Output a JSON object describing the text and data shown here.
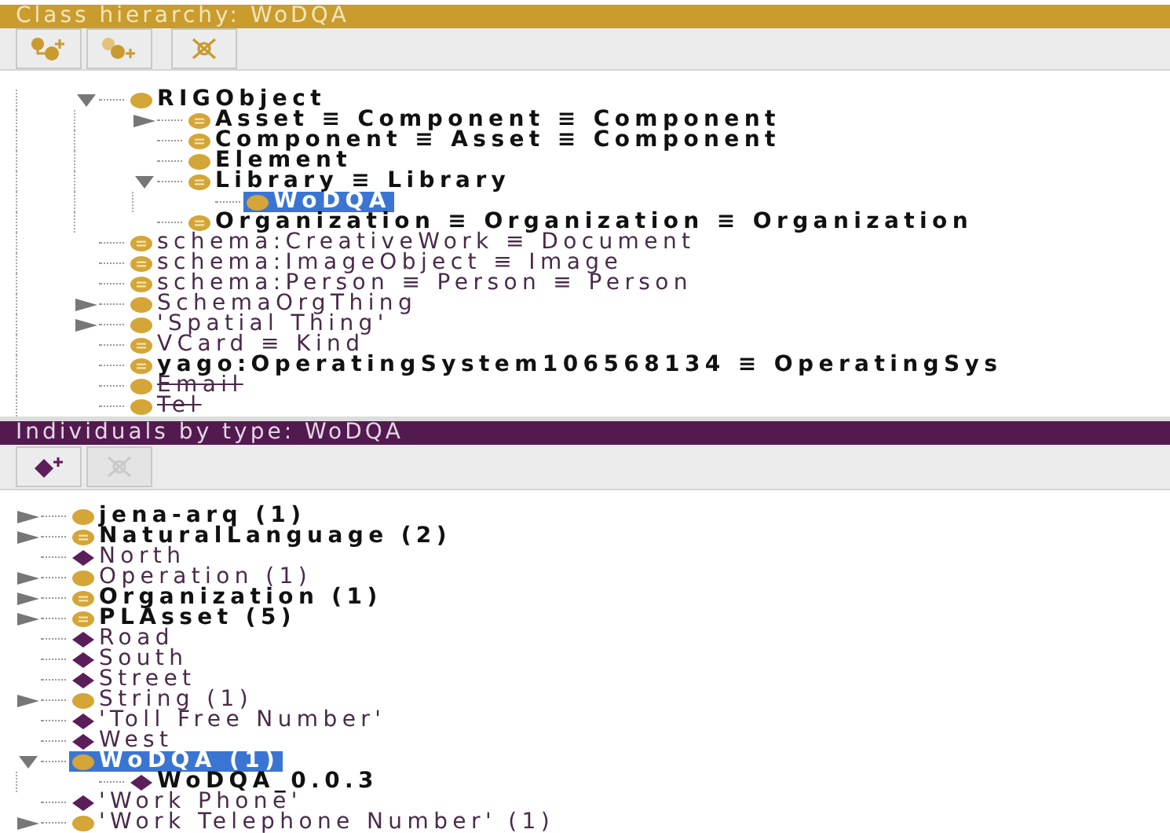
{
  "class_hierarchy": {
    "title": "Class hierarchy: WoDQA",
    "buttons": [
      {
        "kind": "add-subclass",
        "disabled": false
      },
      {
        "kind": "add-sibling",
        "disabled": false
      },
      {
        "kind": "delete",
        "disabled": false
      }
    ],
    "items": [
      {
        "label": "RIGObject",
        "bold": true,
        "equivalent": false,
        "expanded": true,
        "children": [
          {
            "label": "Asset ≡ Component ≡ Component",
            "bold": true,
            "equivalent": true,
            "expanded": false
          },
          {
            "label": "Component ≡ Asset ≡ Component",
            "bold": true,
            "equivalent": true
          },
          {
            "label": "Element",
            "bold": true,
            "equivalent": false
          },
          {
            "label": "Library ≡ Library",
            "bold": true,
            "equivalent": true,
            "expanded": true,
            "children": [
              {
                "label": "WoDQA",
                "bold": true,
                "equivalent": false,
                "selected": true
              }
            ]
          },
          {
            "label": "Organization ≡ Organization ≡ Organization",
            "bold": true,
            "equivalent": true
          }
        ]
      },
      {
        "label": "schema:CreativeWork ≡ Document",
        "bold": false,
        "equivalent": true
      },
      {
        "label": "schema:ImageObject ≡ Image",
        "bold": false,
        "equivalent": true
      },
      {
        "label": "schema:Person ≡ Person ≡ Person",
        "bold": false,
        "equivalent": true
      },
      {
        "label": "SchemaOrgThing",
        "bold": false,
        "equivalent": false,
        "expanded": false
      },
      {
        "label": "'Spatial Thing'",
        "bold": false,
        "equivalent": false,
        "expanded": false
      },
      {
        "label": "VCard ≡ Kind",
        "bold": false,
        "equivalent": true
      },
      {
        "label": "yago:OperatingSystem106568134 ≡ OperatingSys",
        "bold": true,
        "equivalent": true
      },
      {
        "label": "Email",
        "bold": false,
        "equivalent": false,
        "struck": true
      },
      {
        "label": "Tel",
        "bold": false,
        "equivalent": false,
        "struck": true
      }
    ]
  },
  "individuals": {
    "title": "Individuals by type: WoDQA",
    "buttons": [
      {
        "kind": "add-individual",
        "disabled": false
      },
      {
        "kind": "delete",
        "disabled": true
      }
    ],
    "items": [
      {
        "label": "jena-arq (1)",
        "bold": true,
        "kind": "class",
        "expanded": false
      },
      {
        "label": "NaturalLanguage (2)",
        "bold": true,
        "kind": "equivalent",
        "expanded": false
      },
      {
        "label": "North",
        "bold": false,
        "kind": "individual"
      },
      {
        "label": "Operation (1)",
        "bold": false,
        "kind": "class",
        "expanded": false
      },
      {
        "label": "Organization (1)",
        "bold": true,
        "kind": "equivalent",
        "expanded": false
      },
      {
        "label": "PLAsset (5)",
        "bold": true,
        "kind": "equivalent",
        "expanded": false
      },
      {
        "label": "Road",
        "bold": false,
        "kind": "individual"
      },
      {
        "label": "South",
        "bold": false,
        "kind": "individual"
      },
      {
        "label": "Street",
        "bold": false,
        "kind": "individual"
      },
      {
        "label": "String (1)",
        "bold": false,
        "kind": "class",
        "expanded": false
      },
      {
        "label": "'Toll Free Number'",
        "bold": false,
        "kind": "individual"
      },
      {
        "label": "West",
        "bold": false,
        "kind": "individual"
      },
      {
        "label": "WoDQA (1)",
        "bold": true,
        "kind": "class",
        "expanded": true,
        "selected": true,
        "children": [
          {
            "label": "WoDQA_0.0.3",
            "bold": true,
            "kind": "individual"
          }
        ]
      },
      {
        "label": "'Work Phone'",
        "bold": false,
        "kind": "individual"
      },
      {
        "label": "'Work Telephone Number' (1)",
        "bold": false,
        "kind": "class",
        "expanded": false
      }
    ]
  }
}
